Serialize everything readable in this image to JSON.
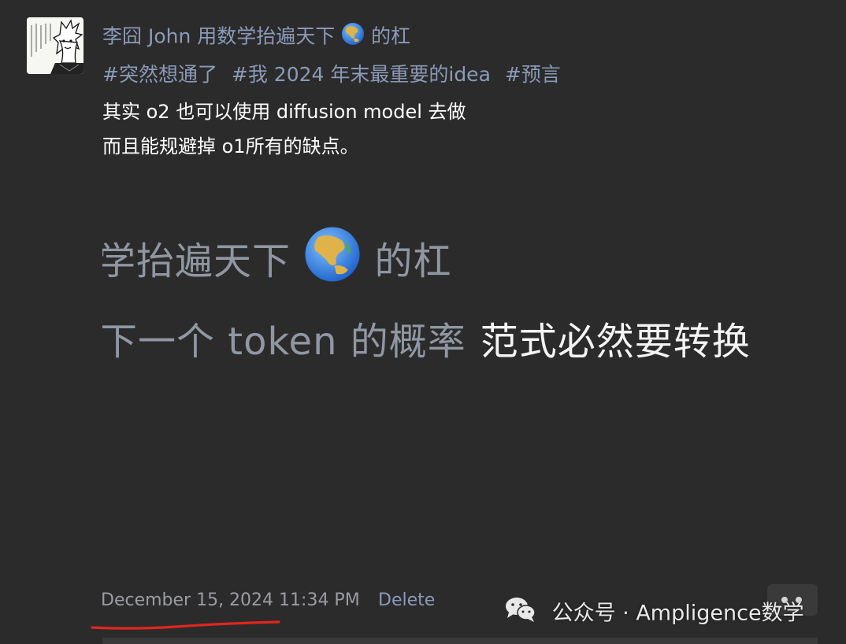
{
  "post": {
    "author": "李囧 John 用数学抬遍天下",
    "author_suffix": "的杠",
    "globe_icon": "globe-asia-icon",
    "hashtags": [
      "#突然想通了",
      "#我 2024 年末最重要的idea",
      "#预言"
    ],
    "body_lines": [
      "其实 o2 也可以使用 diffusion model 去做",
      "而且能规避掉 o1所有的缺点。"
    ],
    "quote_line1_prefix": "学抬遍天下",
    "quote_line1_suffix": "的杠",
    "quote_line2_dim": "下一个 token 的概率",
    "quote_line2_bright": "范式必然要转换"
  },
  "footer": {
    "timestamp": "December 15, 2024 11:34 PM",
    "delete_label": "Delete"
  },
  "watermark": {
    "text": "公众号 · Ampligence数学",
    "icon": "wechat-icon"
  },
  "colors": {
    "background": "#2b2b2b",
    "link": "#8b9ab9",
    "text": "#ffffff",
    "timestamp": "#9a9ca3",
    "underline_annotation": "#e0261e"
  }
}
